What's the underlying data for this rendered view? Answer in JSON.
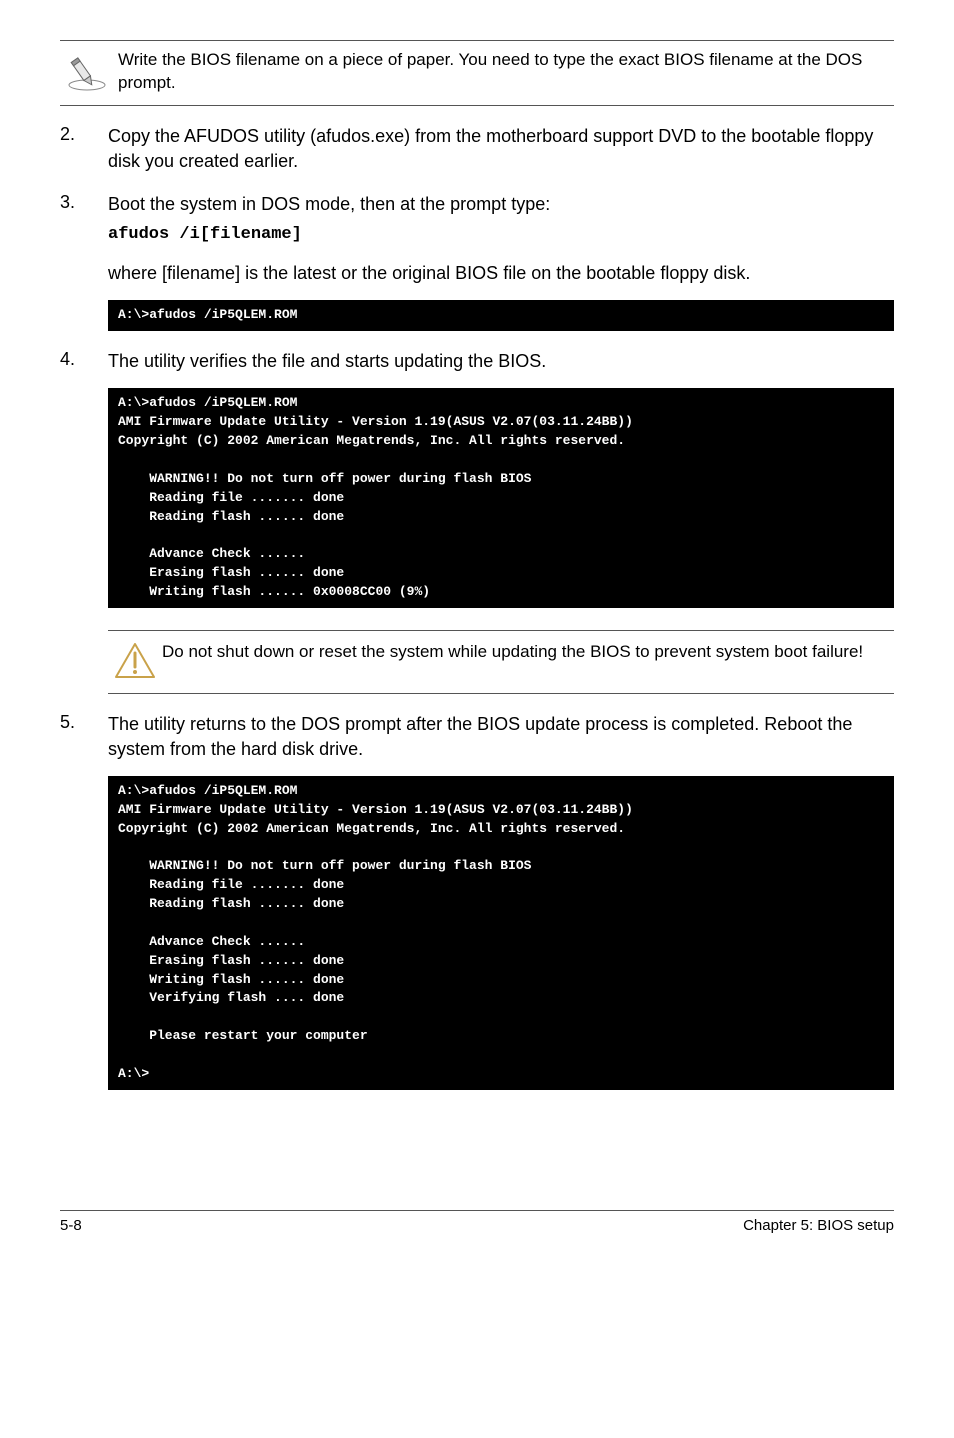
{
  "top_note": "Write the BIOS filename on a piece of paper. You need to type the exact BIOS filename at the DOS prompt.",
  "steps": {
    "s2": {
      "num": "2.",
      "text": "Copy the AFUDOS utility (afudos.exe) from the motherboard support DVD to the bootable floppy disk you created earlier."
    },
    "s3": {
      "num": "3.",
      "text": "Boot the system in DOS mode, then at the prompt type:",
      "cmd": "afudos /i[filename]",
      "where": "where [filename] is the latest or the original BIOS file on the bootable floppy disk."
    },
    "s4": {
      "num": "4.",
      "text": "The utility verifies the file and starts updating the BIOS."
    },
    "s5": {
      "num": "5.",
      "text": "The utility returns to the DOS prompt after the BIOS update process is completed. Reboot the system from the hard disk drive."
    }
  },
  "term1": "A:\\>afudos /iP5QLEM.ROM",
  "term2": "A:\\>afudos /iP5QLEM.ROM\nAMI Firmware Update Utility - Version 1.19(ASUS V2.07(03.11.24BB))\nCopyright (C) 2002 American Megatrends, Inc. All rights reserved.\n\n    WARNING!! Do not turn off power during flash BIOS\n    Reading file ....... done\n    Reading flash ...... done\n\n    Advance Check ......\n    Erasing flash ...... done\n    Writing flash ...... 0x0008CC00 (9%)",
  "term3": "A:\\>afudos /iP5QLEM.ROM\nAMI Firmware Update Utility - Version 1.19(ASUS V2.07(03.11.24BB))\nCopyright (C) 2002 American Megatrends, Inc. All rights reserved.\n\n    WARNING!! Do not turn off power during flash BIOS\n    Reading file ....... done\n    Reading flash ...... done\n\n    Advance Check ......\n    Erasing flash ...... done\n    Writing flash ...... done\n    Verifying flash .... done\n\n    Please restart your computer\n\nA:\\>",
  "warning": "Do not shut down or reset the system while updating the BIOS to prevent system boot failure!",
  "footer_left": "5-8",
  "footer_right": "Chapter 5: BIOS setup"
}
